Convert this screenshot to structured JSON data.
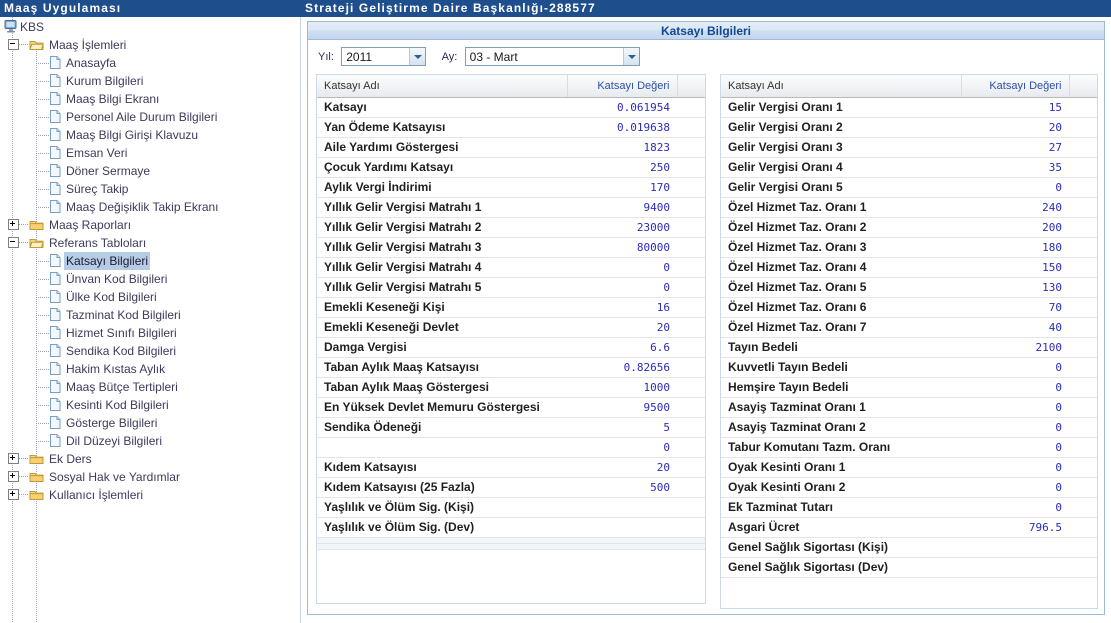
{
  "titlebar": {
    "app_title": "Maaş Uygulaması",
    "institution": "Strateji Geliştirme Daire Başkanlığı-288577",
    "bg_color": "#1f4e8c"
  },
  "tree": {
    "root": {
      "label": "KBS",
      "icon": "computer-icon"
    },
    "nodes": [
      {
        "label": "Maaş İşlemleri",
        "type": "folder",
        "state": "expanded",
        "depth": 1
      },
      {
        "label": "Anasayfa",
        "type": "doc",
        "depth": 2
      },
      {
        "label": "Kurum Bilgileri",
        "type": "doc",
        "depth": 2
      },
      {
        "label": "Maaş Bilgi Ekranı",
        "type": "doc",
        "depth": 2
      },
      {
        "label": "Personel Aile Durum Bilgileri",
        "type": "doc",
        "depth": 2
      },
      {
        "label": "Maaş Bilgi Girişi Klavuzu",
        "type": "doc",
        "depth": 2
      },
      {
        "label": "Emsan Veri",
        "type": "doc",
        "depth": 2
      },
      {
        "label": "Döner Sermaye",
        "type": "doc",
        "depth": 2
      },
      {
        "label": "Süreç Takip",
        "type": "doc",
        "depth": 2
      },
      {
        "label": "Maaş Değişiklik Takip Ekranı",
        "type": "doc",
        "depth": 2
      },
      {
        "label": "Maaş Raporları",
        "type": "folder",
        "state": "collapsed",
        "depth": 1
      },
      {
        "label": "Referans Tabloları",
        "type": "folder",
        "state": "expanded",
        "depth": 1
      },
      {
        "label": "Katsayı Bilgileri",
        "type": "doc",
        "depth": 2,
        "selected": true
      },
      {
        "label": "Ünvan Kod Bilgileri",
        "type": "doc",
        "depth": 2
      },
      {
        "label": "Ülke Kod Bilgileri",
        "type": "doc",
        "depth": 2
      },
      {
        "label": "Tazminat Kod Bilgileri",
        "type": "doc",
        "depth": 2
      },
      {
        "label": "Hizmet Sınıfı Bilgileri",
        "type": "doc",
        "depth": 2
      },
      {
        "label": "Sendika Kod Bilgileri",
        "type": "doc",
        "depth": 2
      },
      {
        "label": "Hakim Kıstas Aylık",
        "type": "doc",
        "depth": 2
      },
      {
        "label": "Maaş Bütçe Tertipleri",
        "type": "doc",
        "depth": 2
      },
      {
        "label": "Kesinti Kod Bilgileri",
        "type": "doc",
        "depth": 2
      },
      {
        "label": "Gösterge Bilgileri",
        "type": "doc",
        "depth": 2
      },
      {
        "label": "Dil Düzeyi Bilgileri",
        "type": "doc",
        "depth": 2
      },
      {
        "label": "Ek Ders",
        "type": "folder",
        "state": "collapsed",
        "depth": 1
      },
      {
        "label": "Sosyal Hak ve Yardımlar",
        "type": "folder",
        "state": "collapsed",
        "depth": 1
      },
      {
        "label": "Kullanıcı İşlemleri",
        "type": "folder",
        "state": "collapsed",
        "depth": 1
      }
    ]
  },
  "panel": {
    "title": "Katsayı Bilgileri",
    "title_color": "#15488f",
    "filters": {
      "year": {
        "label": "Yıl:",
        "value": "2011"
      },
      "month": {
        "label": "Ay:",
        "value": "03 - Mart"
      }
    }
  },
  "grid_left": {
    "columns": [
      "Katsayı Adı",
      "Katsayı Değeri"
    ],
    "rows": [
      {
        "name": "Katsayı",
        "value": "0.061954"
      },
      {
        "name": "Yan Ödeme Katsayısı",
        "value": "0.019638"
      },
      {
        "name": "Aile Yardımı Göstergesi",
        "value": "1823"
      },
      {
        "name": "Çocuk Yardımı Katsayı",
        "value": "250"
      },
      {
        "name": "Aylık Vergi İndirimi",
        "value": "170"
      },
      {
        "name": "Yıllık Gelir Vergisi Matrahı 1",
        "value": "9400"
      },
      {
        "name": "Yıllık Gelir Vergisi Matrahı 2",
        "value": "23000"
      },
      {
        "name": "Yıllık Gelir Vergisi Matrahı 3",
        "value": "80000"
      },
      {
        "name": "Yıllık Gelir Vergisi Matrahı 4",
        "value": "0"
      },
      {
        "name": "Yıllık Gelir Vergisi Matrahı 5",
        "value": "0"
      },
      {
        "name": "Emekli Keseneği Kişi",
        "value": "16"
      },
      {
        "name": "Emekli Keseneği Devlet",
        "value": "20"
      },
      {
        "name": "Damga Vergisi",
        "value": "6.6"
      },
      {
        "name": "Taban Aylık Maaş Katsayısı",
        "value": "0.82656"
      },
      {
        "name": "Taban Aylık Maaş Göstergesi",
        "value": "1000"
      },
      {
        "name": "En Yüksek Devlet Memuru Göstergesi",
        "value": "9500"
      },
      {
        "name": "Sendika Ödeneği",
        "value": "5"
      },
      {
        "name": "",
        "value": "0"
      },
      {
        "name": "Kıdem Katsayısı",
        "value": "20"
      },
      {
        "name": "Kıdem Katsayısı (25 Fazla)",
        "value": "500"
      },
      {
        "name": "Yaşlılık ve Ölüm Sig. (Kişi)",
        "value": ""
      },
      {
        "name": "Yaşlılık ve Ölüm Sig. (Dev)",
        "value": ""
      }
    ]
  },
  "grid_right": {
    "columns": [
      "Katsayı Adı",
      "Katsayı Değeri"
    ],
    "rows": [
      {
        "name": "Gelir Vergisi Oranı 1",
        "value": "15"
      },
      {
        "name": "Gelir Vergisi Oranı 2",
        "value": "20"
      },
      {
        "name": "Gelir Vergisi Oranı 3",
        "value": "27"
      },
      {
        "name": "Gelir Vergisi Oranı 4",
        "value": "35"
      },
      {
        "name": "Gelir Vergisi Oranı 5",
        "value": "0"
      },
      {
        "name": "Özel Hizmet Taz. Oranı 1",
        "value": "240"
      },
      {
        "name": "Özel Hizmet Taz. Oranı 2",
        "value": "200"
      },
      {
        "name": "Özel Hizmet Taz. Oranı 3",
        "value": "180"
      },
      {
        "name": "Özel Hizmet Taz. Oranı 4",
        "value": "150"
      },
      {
        "name": "Özel Hizmet Taz. Oranı 5",
        "value": "130"
      },
      {
        "name": "Özel Hizmet Taz. Oranı 6",
        "value": "70"
      },
      {
        "name": "Özel Hizmet Taz. Oranı 7",
        "value": "40"
      },
      {
        "name": "Tayın Bedeli",
        "value": "2100"
      },
      {
        "name": "Kuvvetli Tayın Bedeli",
        "value": "0"
      },
      {
        "name": "Hemşire Tayın Bedeli",
        "value": "0"
      },
      {
        "name": "Asayiş Tazminat Oranı 1",
        "value": "0"
      },
      {
        "name": "Asayiş Tazminat Oranı 2",
        "value": "0"
      },
      {
        "name": "Tabur Komutanı Tazm. Oranı",
        "value": "0"
      },
      {
        "name": "Oyak Kesinti Oranı 1",
        "value": "0"
      },
      {
        "name": "Oyak Kesinti Oranı 2",
        "value": "0"
      },
      {
        "name": "Ek Tazminat Tutarı",
        "value": "0"
      },
      {
        "name": "Asgari Ücret",
        "value": "796.5"
      },
      {
        "name": "Genel Sağlık Sigortası (Kişi)",
        "value": ""
      },
      {
        "name": "Genel Sağlık Sigortası (Dev)",
        "value": ""
      }
    ]
  }
}
